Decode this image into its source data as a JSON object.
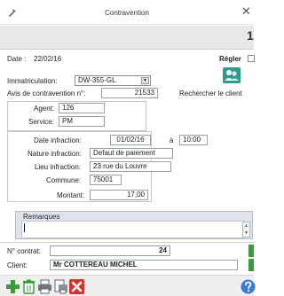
{
  "window": {
    "title": "Contravention",
    "close_glyph": "✕",
    "record_number_fragment": "1"
  },
  "header": {
    "date_label": "Date :",
    "date_value": "22/02/16",
    "settle_label": "Régler"
  },
  "vehicle": {
    "immat_label": "Immatriculation:",
    "immat_value": "DW-355-GL",
    "avis_label": "Avis de contravention n°:",
    "avis_value": "21533",
    "search_label": "Rechercher le client"
  },
  "agent": {
    "agent_label": "Agent:",
    "agent_value": "126",
    "service_label": "Service:",
    "service_value": "PM"
  },
  "infraction": {
    "date_label": "Date infraction:",
    "date_value": "01/02/16",
    "time_sep": "à",
    "time_value": "10:00",
    "nature_label": "Nature infraction:",
    "nature_value": "Defaut de paiement",
    "lieu_label": "Lieu infraction:",
    "lieu_value": "23 rue du Louvre",
    "commune_label": "Commune:",
    "commune_value": "75001",
    "montant_label": "Montant:",
    "montant_value": "17,00"
  },
  "remarks": {
    "label": "Remarques",
    "value": ""
  },
  "contract": {
    "number_label": "N° contrat:",
    "number_value": "24",
    "client_label": "Client:",
    "client_value": "Mr COTTEREAU MICHEL"
  },
  "toolbar_icons": [
    "add-icon",
    "trash-icon",
    "printer-icon",
    "preview-icon",
    "cancel-icon",
    "help-icon"
  ],
  "colors": {
    "accent_teal": "#2a9d8f",
    "green": "#3b9a3b",
    "red": "#d9342b",
    "help_blue": "#3a7bd5"
  }
}
